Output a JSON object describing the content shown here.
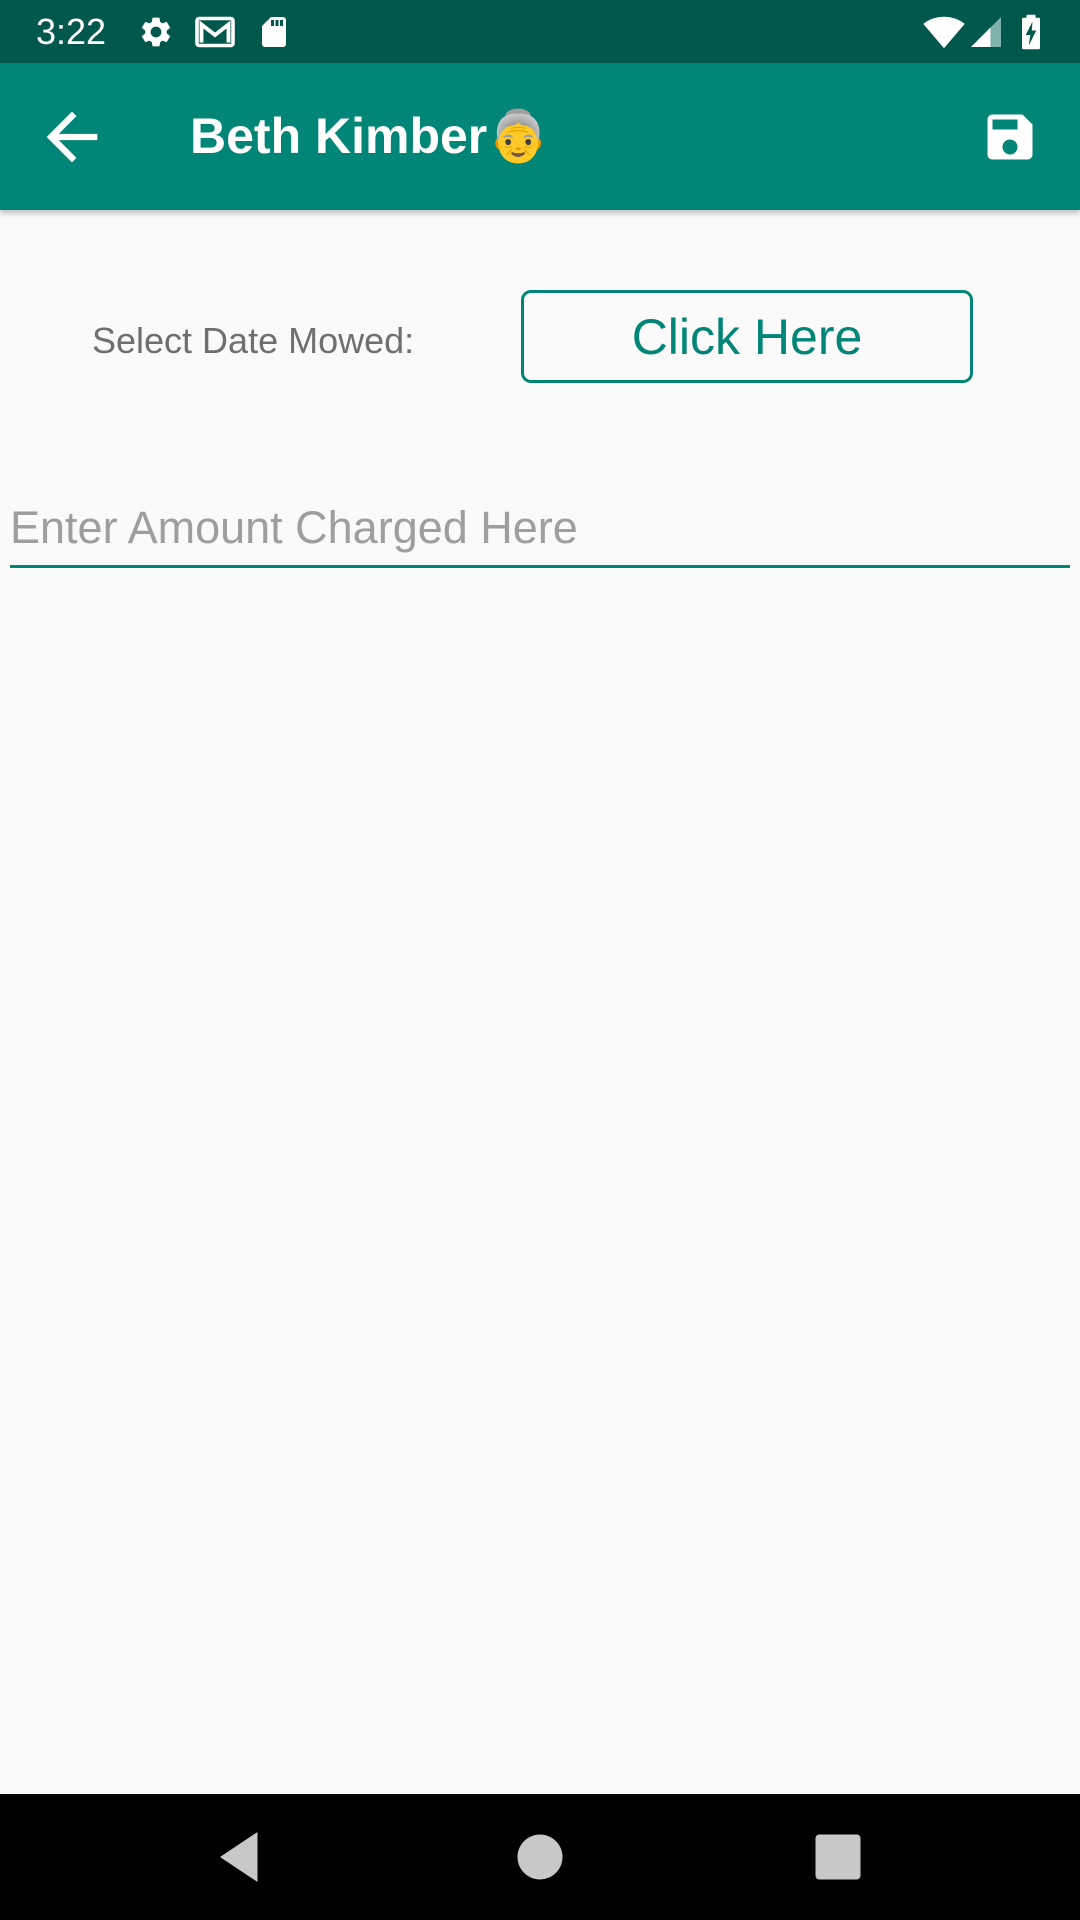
{
  "status_bar": {
    "time": "3:22",
    "icons_left": [
      "settings-icon",
      "gmail-icon",
      "sd-card-icon"
    ],
    "icons_right": [
      "wifi-icon",
      "cell-signal-icon",
      "battery-charging-icon"
    ],
    "background_color": "#00574b"
  },
  "toolbar": {
    "title": "Beth Kimber👵",
    "back_icon": "arrow-back-icon",
    "save_icon": "save-icon",
    "background_color": "#008577"
  },
  "form": {
    "date_label": "Select Date Mowed:",
    "date_button_label": "Click Here",
    "amount_placeholder": "Enter Amount Charged Here",
    "amount_value": "",
    "accent_color": "#008577"
  },
  "nav_bar": {
    "buttons": [
      "back-triangle-icon",
      "home-circle-icon",
      "recents-square-icon"
    ]
  }
}
